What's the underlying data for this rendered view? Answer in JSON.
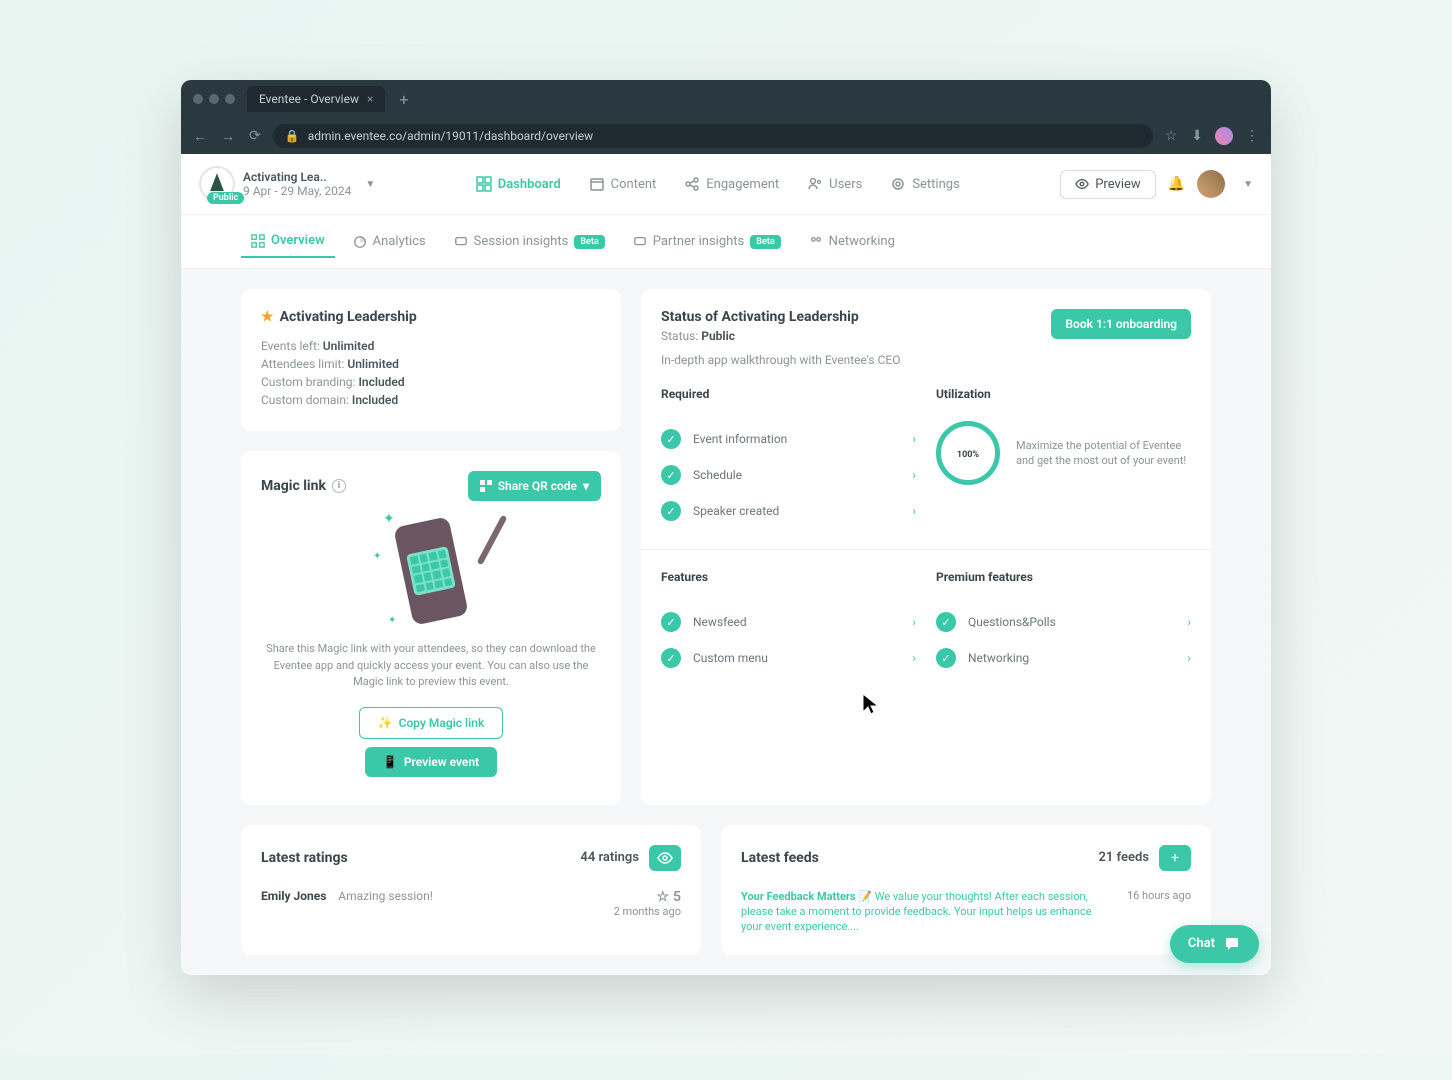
{
  "browser": {
    "tab_title": "Eventee - Overview",
    "url": "admin.eventee.co/admin/19011/dashboard/overview"
  },
  "header": {
    "event_name": "Activating Lea..",
    "event_badge": "Public",
    "event_dates": "9 Apr - 29 May, 2024",
    "nav": [
      {
        "label": "Dashboard",
        "active": true
      },
      {
        "label": "Content"
      },
      {
        "label": "Engagement"
      },
      {
        "label": "Users"
      },
      {
        "label": "Settings"
      }
    ],
    "preview_label": "Preview"
  },
  "subnav": [
    {
      "label": "Overview",
      "active": true
    },
    {
      "label": "Analytics"
    },
    {
      "label": "Session insights",
      "badge": "Beta"
    },
    {
      "label": "Partner insights",
      "badge": "Beta"
    },
    {
      "label": "Networking"
    }
  ],
  "plan_card": {
    "title": "Activating Leadership",
    "stats": [
      {
        "label": "Events left:",
        "value": "Unlimited"
      },
      {
        "label": "Attendees limit:",
        "value": "Unlimited"
      },
      {
        "label": "Custom branding:",
        "value": "Included"
      },
      {
        "label": "Custom domain:",
        "value": "Included"
      }
    ]
  },
  "magic_link": {
    "title": "Magic link",
    "share_qr": "Share QR code",
    "description": "Share this Magic link with your attendees, so they can download the Eventee app and quickly access your event. You can also use the Magic link to preview this event.",
    "copy_label": "Copy Magic link",
    "preview_label": "Preview event"
  },
  "status_card": {
    "title": "Status of Activating Leadership",
    "status_label": "Status:",
    "status_value": "Public",
    "subtitle": "In-depth app walkthrough with Eventee's CEO",
    "book_btn": "Book 1:1 onboarding",
    "required_label": "Required",
    "utilization_label": "Utilization",
    "required": [
      "Event information",
      "Schedule",
      "Speaker created"
    ],
    "utilization_pct": "100",
    "utilization_text": "Maximize the potential of Eventee and get the most out of your event!",
    "features_label": "Features",
    "premium_label": "Premium features",
    "features": [
      "Newsfeed",
      "Custom menu"
    ],
    "premium": [
      "Questions&Polls",
      "Networking"
    ]
  },
  "ratings": {
    "title": "Latest ratings",
    "count": "44 ratings",
    "item": {
      "author": "Emily Jones",
      "text": "Amazing session!",
      "score": "5",
      "time": "2 months ago"
    }
  },
  "feeds": {
    "title": "Latest feeds",
    "count": "21 feeds",
    "item": {
      "title": "Your Feedback Matters 📝",
      "body": "We value your thoughts! After each session, please take a moment to provide feedback. Your input helps us enhance your event experience....",
      "time": "16 hours ago"
    }
  },
  "chat_label": "Chat"
}
